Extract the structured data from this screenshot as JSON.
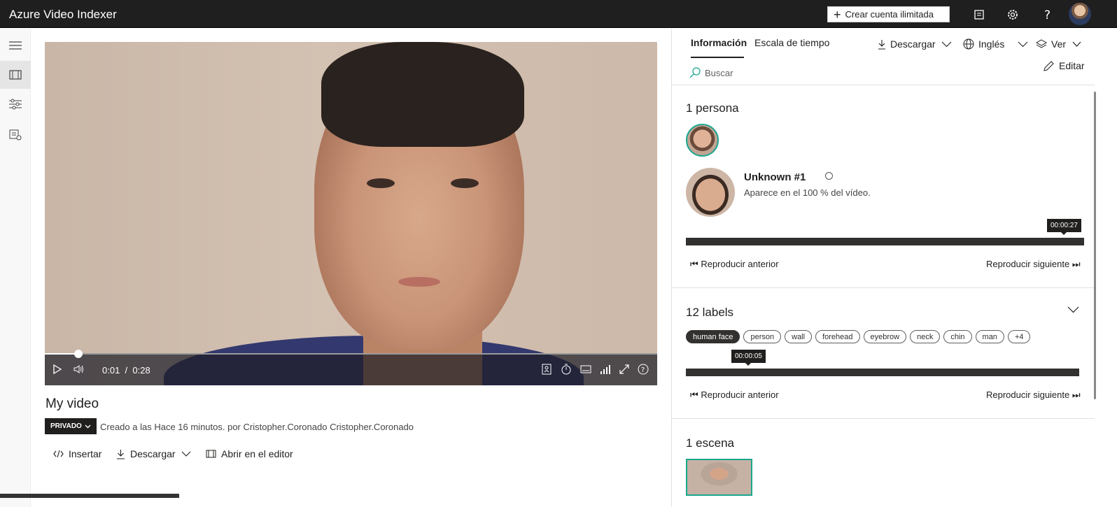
{
  "app": {
    "title": "Azure Video Indexer",
    "create_button": "Crear cuenta ilimitada"
  },
  "player": {
    "current_time": "0:01",
    "separator": "/",
    "duration": "0:28",
    "progress_fraction": 0.036
  },
  "video": {
    "title": "My video",
    "privacy_badge": "PRIVADO",
    "created_text": "Creado a las Hace 16 minutos. por Cristopher.Coronado Cristopher.Coronado"
  },
  "actions": {
    "embed": "Insertar",
    "download": "Descargar",
    "open_editor": "Abrir en el editor"
  },
  "panel": {
    "tabs": [
      "Información",
      "Escala de tiempo"
    ],
    "download": "Descargar",
    "language": "Inglés",
    "view": "Ver",
    "search_placeholder": "Buscar",
    "edit": "Editar",
    "people": {
      "title": "1 persona",
      "name": "Unknown #1",
      "appearance": "Aparece en el 100 % del vídeo.",
      "tooltip": "00:00:27",
      "prev": "Reproducir anterior",
      "next": "Reproducir siguiente"
    },
    "labels": {
      "title": "12 labels",
      "items": [
        "human face",
        "person",
        "wall",
        "forehead",
        "eyebrow",
        "neck",
        "chin",
        "man",
        "+4"
      ],
      "tooltip": "00:00:05",
      "prev": "Reproducir anterior",
      "next": "Reproducir siguiente"
    },
    "scenes": {
      "title": "1 escena"
    }
  }
}
